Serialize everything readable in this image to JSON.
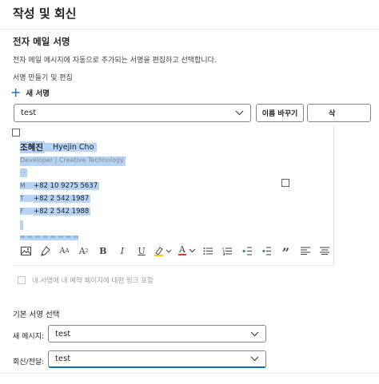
{
  "page": {
    "title": "작성 및 회신"
  },
  "signature_section": {
    "title": "전자 메일 서명",
    "description": "전자 메일 메시지에 자동으로 추가되는 서명을 편집하고 선택합니다.",
    "subheading": "서명 만들기 및 편집",
    "new_signature_label": "새 서명",
    "selected_signature": "test",
    "rename_button": "이름 바꾸기",
    "delete_button": "삭"
  },
  "editor": {
    "name_ko": "조혜진",
    "name_en": "Hyejin Cho",
    "role": "Developer | Creative Technology",
    "dots": "...",
    "mobile_label": "M",
    "mobile_value": "+82 10 9275 5637",
    "tel_label": "T",
    "tel_value": "+82 2 542 1987",
    "fax_label": "F",
    "fax_value": "+82 2 542 1988",
    "highlight_color": "#b4d3f5"
  },
  "toolbar": {
    "icons": [
      "insert-image-icon",
      "format-painter-icon",
      "font-size-icon",
      "superscript-icon",
      "bold-icon",
      "italic-icon",
      "underline-icon",
      "highlight-icon",
      "font-color-icon",
      "bullet-list-icon",
      "numbered-list-icon",
      "decrease-indent-icon",
      "increase-indent-icon",
      "quote-icon",
      "align-left-icon",
      "align-center-icon"
    ],
    "font_size_glyph": "A",
    "superscript_glyph": "A",
    "bold_glyph": "B",
    "italic_glyph": "I",
    "underline_glyph": "U",
    "font_color_glyph": "A",
    "quote_glyph": "”",
    "highlight_color": "#f2c811",
    "font_color": "#d13438"
  },
  "reservation_link": {
    "label": "내 서명에 내 예약 페이지에 대한 링크 포함",
    "checked": false
  },
  "defaults": {
    "heading": "기본 서명 선택",
    "new_message_label": "새 메시지:",
    "new_message_value": "test",
    "reply_label": "회신/전달:",
    "reply_value": "test"
  },
  "colors": {
    "accent": "#0f6cbd",
    "text": "#242424",
    "muted": "#424242",
    "disabled": "#a19f9d"
  }
}
